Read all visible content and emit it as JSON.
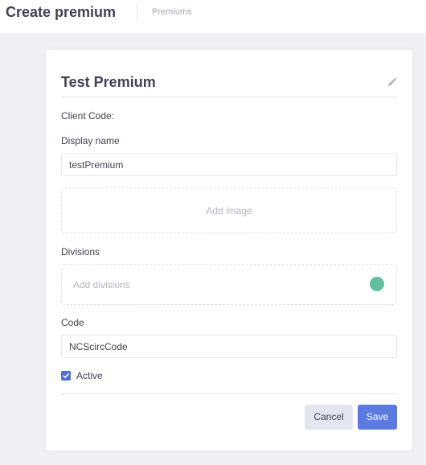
{
  "header": {
    "title": "Create premium",
    "breadcrumb": "Premiums"
  },
  "form": {
    "title": "Test Premium",
    "edit_icon": "pencil-icon",
    "client_code_label": "Client Code:",
    "display_name_label": "Display name",
    "display_name_value": "testPremium",
    "add_image_label": "Add image",
    "divisions_label": "Divisions",
    "divisions_placeholder": "Add divisions",
    "code_label": "Code",
    "code_value": "NCScircCode",
    "active_label": "Active",
    "active_checked": true,
    "cancel_label": "Cancel",
    "save_label": "Save"
  },
  "colors": {
    "accent": "#5b7be0",
    "divisions_add_dot": "#5fbf9e",
    "checkbox": "#4f6fd6"
  }
}
